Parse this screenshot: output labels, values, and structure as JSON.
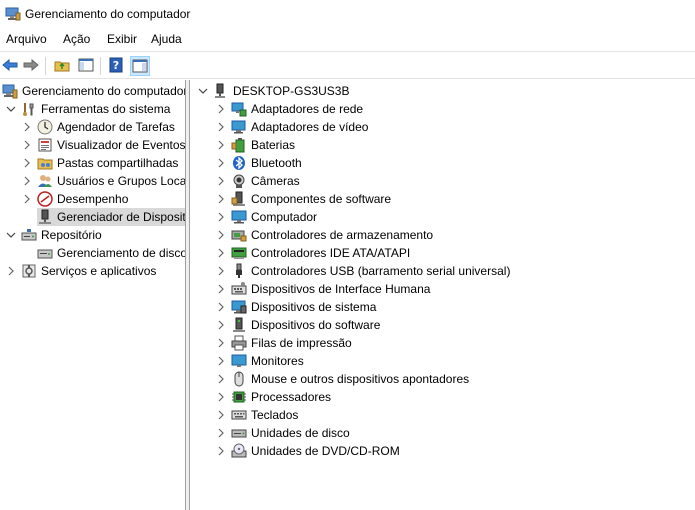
{
  "window": {
    "title": "Gerenciamento do computador"
  },
  "menu": [
    "Arquivo",
    "Ação",
    "Exibir",
    "Ajuda"
  ],
  "left_tree": [
    {
      "label": "Gerenciamento do computador",
      "level": 0,
      "expander": "none",
      "icon": "computer-management-icon"
    },
    {
      "label": "Ferramentas do sistema",
      "level": 1,
      "expander": "expanded",
      "icon": "tools-icon"
    },
    {
      "label": "Agendador de Tarefas",
      "level": 2,
      "expander": "collapsed",
      "icon": "clock-icon"
    },
    {
      "label": "Visualizador de Eventos",
      "level": 2,
      "expander": "collapsed",
      "icon": "event-viewer-icon"
    },
    {
      "label": "Pastas compartilhadas",
      "level": 2,
      "expander": "collapsed",
      "icon": "shared-folder-icon"
    },
    {
      "label": "Usuários e Grupos Loca",
      "level": 2,
      "expander": "collapsed",
      "icon": "users-icon"
    },
    {
      "label": "Desempenho",
      "level": 2,
      "expander": "collapsed",
      "icon": "performance-icon"
    },
    {
      "label": "Gerenciador de Disposit",
      "level": 2,
      "expander": "none",
      "icon": "device-manager-icon",
      "selected": true
    },
    {
      "label": "Repositório",
      "level": 1,
      "expander": "expanded",
      "icon": "storage-icon"
    },
    {
      "label": "Gerenciamento de disco",
      "level": 2,
      "expander": "none",
      "icon": "disk-management-icon"
    },
    {
      "label": "Serviços e aplicativos",
      "level": 1,
      "expander": "collapsed",
      "icon": "services-icon"
    }
  ],
  "device_tree": {
    "root": "DESKTOP-GS3US3B",
    "categories": [
      {
        "label": "Adaptadores de rede",
        "icon": "network-adapter-icon"
      },
      {
        "label": "Adaptadores de vídeo",
        "icon": "display-adapter-icon"
      },
      {
        "label": "Baterias",
        "icon": "battery-icon"
      },
      {
        "label": "Bluetooth",
        "icon": "bluetooth-icon"
      },
      {
        "label": "Câmeras",
        "icon": "camera-icon"
      },
      {
        "label": "Componentes de software",
        "icon": "software-component-icon"
      },
      {
        "label": "Computador",
        "icon": "computer-icon"
      },
      {
        "label": "Controladores de armazenamento",
        "icon": "storage-controller-icon"
      },
      {
        "label": "Controladores IDE ATA/ATAPI",
        "icon": "ide-controller-icon"
      },
      {
        "label": "Controladores USB (barramento serial universal)",
        "icon": "usb-icon"
      },
      {
        "label": "Dispositivos de Interface Humana",
        "icon": "hid-icon"
      },
      {
        "label": "Dispositivos de sistema",
        "icon": "system-device-icon"
      },
      {
        "label": "Dispositivos do software",
        "icon": "software-device-icon"
      },
      {
        "label": "Filas de impressão",
        "icon": "printer-icon"
      },
      {
        "label": "Monitores",
        "icon": "monitor-icon"
      },
      {
        "label": "Mouse e outros dispositivos apontadores",
        "icon": "mouse-icon"
      },
      {
        "label": "Processadores",
        "icon": "processor-icon"
      },
      {
        "label": "Teclados",
        "icon": "keyboard-icon"
      },
      {
        "label": "Unidades de disco",
        "icon": "disk-drive-icon"
      },
      {
        "label": "Unidades de DVD/CD-ROM",
        "icon": "dvd-icon"
      }
    ]
  }
}
